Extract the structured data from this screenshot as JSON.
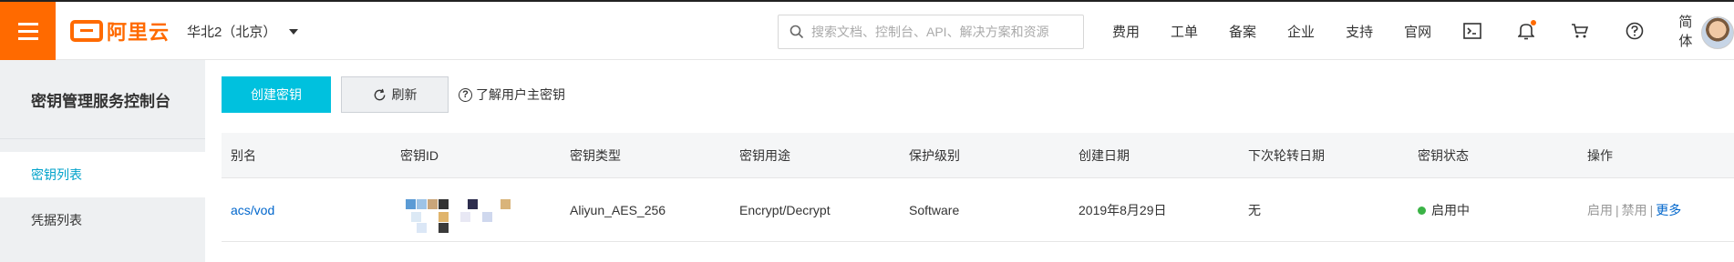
{
  "header": {
    "logo_text": "阿里云",
    "region": "华北2（北京）",
    "search_placeholder": "搜索文档、控制台、API、解决方案和资源",
    "nav": [
      "费用",
      "工单",
      "备案",
      "企业",
      "支持",
      "官网"
    ],
    "icons": [
      "terminal-icon",
      "bell-icon",
      "cart-icon",
      "help-icon"
    ],
    "language": "简体",
    "brand_color": "#ff6a00"
  },
  "sidebar": {
    "title": "密钥管理服务控制台",
    "items": [
      {
        "label": "密钥列表",
        "active": true
      },
      {
        "label": "凭据列表",
        "active": false
      }
    ]
  },
  "toolbar": {
    "create_label": "创建密钥",
    "refresh_label": "刷新",
    "help_label": "了解用户主密钥"
  },
  "table": {
    "columns": [
      "别名",
      "密钥ID",
      "密钥类型",
      "密钥用途",
      "保护级别",
      "创建日期",
      "下次轮转日期",
      "密钥状态",
      "操作"
    ],
    "rows": [
      {
        "alias": "acs/vod",
        "key_id": "",
        "key_type": "Aliyun_AES_256",
        "usage": "Encrypt/Decrypt",
        "protection": "Software",
        "created": "2019年8月29日",
        "next_rotation": "无",
        "status": "启用中",
        "actions": {
          "enable": "启用",
          "disable": "禁用",
          "more": "更多"
        }
      }
    ]
  },
  "colors": {
    "accent": "#00c1de",
    "link": "#0066cc",
    "status_ok": "#3bb346"
  }
}
